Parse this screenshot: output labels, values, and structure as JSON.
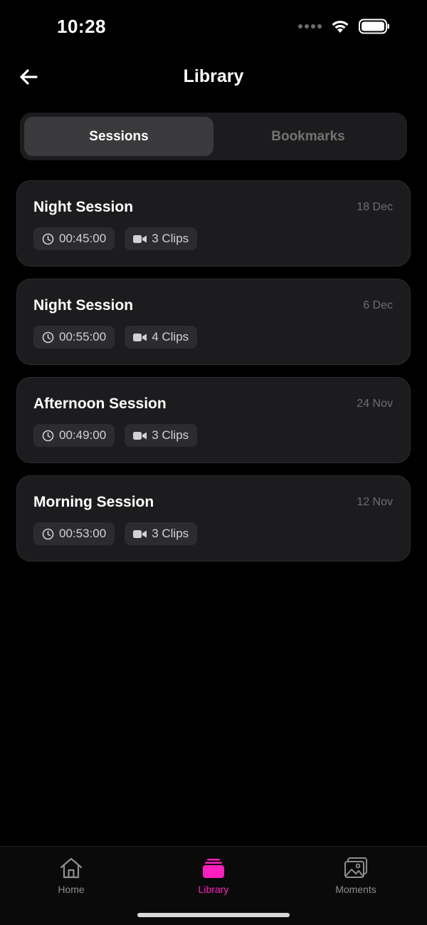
{
  "status": {
    "time": "10:28"
  },
  "header": {
    "title": "Library",
    "back_icon": "arrow-left-icon"
  },
  "segments": [
    {
      "label": "Sessions",
      "active": true
    },
    {
      "label": "Bookmarks",
      "active": false
    }
  ],
  "sessions": [
    {
      "title": "Night Session",
      "date": "18 Dec",
      "duration": "00:45:00",
      "clips": "3 Clips"
    },
    {
      "title": "Night Session",
      "date": "6 Dec",
      "duration": "00:55:00",
      "clips": "4 Clips"
    },
    {
      "title": "Afternoon Session",
      "date": "24 Nov",
      "duration": "00:49:00",
      "clips": "3 Clips"
    },
    {
      "title": "Morning Session",
      "date": "12 Nov",
      "duration": "00:53:00",
      "clips": "3 Clips"
    }
  ],
  "tabs": [
    {
      "label": "Home",
      "icon": "home-icon",
      "active": false
    },
    {
      "label": "Library",
      "icon": "library-stack-icon",
      "active": true
    },
    {
      "label": "Moments",
      "icon": "photos-icon",
      "active": false
    }
  ],
  "colors": {
    "accent": "#ff1ebe",
    "card": "#1c1c1e",
    "chip": "#2c2c2e",
    "background": "#000000"
  }
}
